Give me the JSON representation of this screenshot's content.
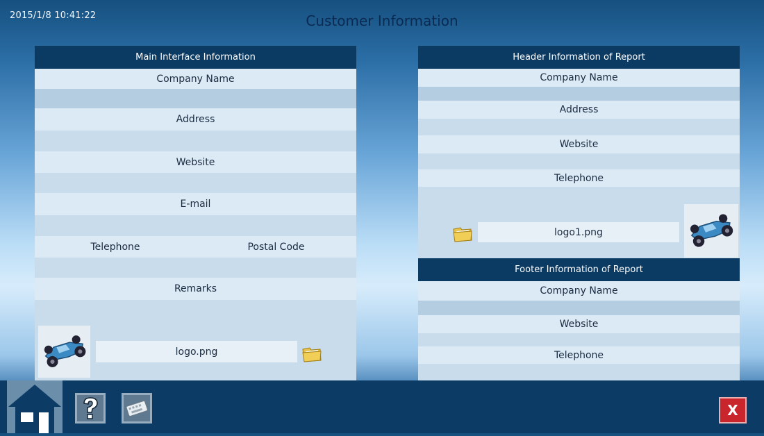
{
  "header": {
    "timestamp": "2015/1/8 10:41:22",
    "title": "Customer Information"
  },
  "left_panel": {
    "title": "Main Interface Information",
    "labels": {
      "company_name": "Company Name",
      "address": "Address",
      "website": "Website",
      "email": "E-mail",
      "telephone": "Telephone",
      "postal_code": "Postal Code",
      "remarks": "Remarks"
    },
    "values": {
      "company_name": "",
      "address": "",
      "website": "",
      "email": "",
      "telephone": "",
      "postal_code": "",
      "remarks": ""
    },
    "logo_file": "logo.png"
  },
  "header_panel": {
    "title": "Header Information of Report",
    "labels": {
      "company_name": "Company Name",
      "address": "Address",
      "website": "Website",
      "telephone": "Telephone"
    },
    "values": {
      "company_name": "",
      "address": "",
      "website": "",
      "telephone": ""
    },
    "logo_file": "logo1.png"
  },
  "footer_panel": {
    "title": "Footer Information of Report",
    "labels": {
      "company_name": "Company Name",
      "website": "Website",
      "telephone": "Telephone"
    },
    "values": {
      "company_name": "",
      "website": "",
      "telephone": ""
    }
  },
  "toolbar": {
    "close_label": "X"
  },
  "colors": {
    "panel_header": "#0b3a63",
    "label_row": "#dbeaf5",
    "input_row": "#b5cde0",
    "bottom_bar": "#0c3b66",
    "close_button": "#c9252c"
  },
  "icons": [
    "home-icon",
    "help-icon",
    "keyboard-icon",
    "folder-icon",
    "car-logo-icon",
    "close-icon"
  ]
}
